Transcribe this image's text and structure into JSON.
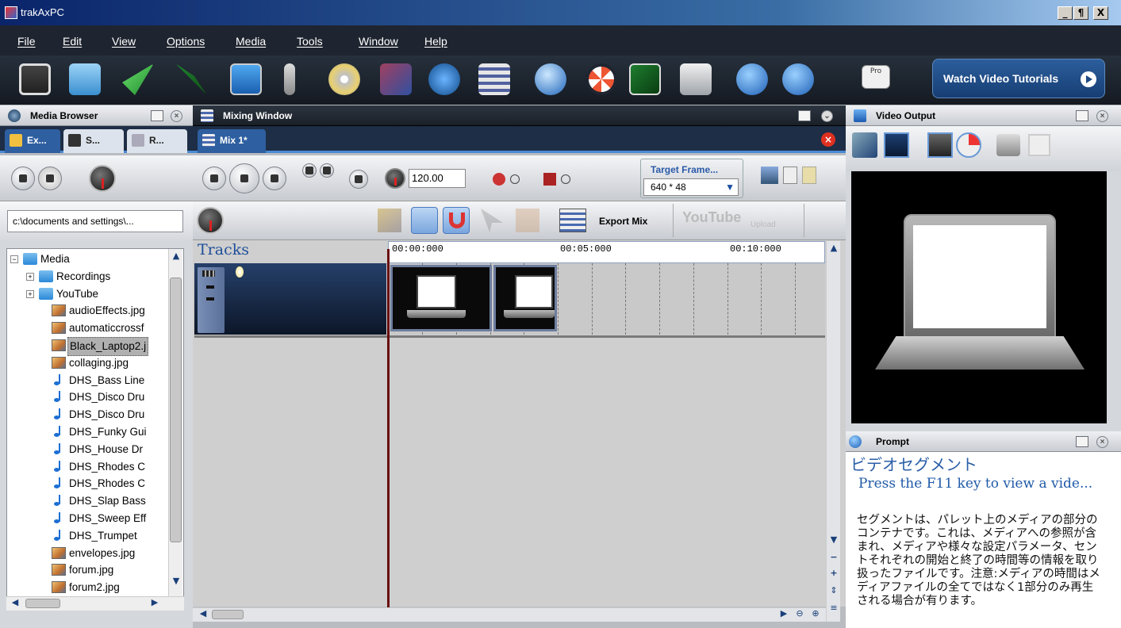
{
  "window": {
    "title": "trakAxPC",
    "controls": [
      "_",
      "¶",
      "X"
    ]
  },
  "menu": [
    "File",
    "Edit",
    "View",
    "Options",
    "Media",
    "Tools",
    "Window",
    "Help"
  ],
  "toolbar": {
    "icons": [
      "save-icon",
      "open-icon",
      "import-icon",
      "export-icon",
      "monitor-icon",
      "microphone-icon",
      "cd-burn-icon",
      "effects-icon",
      "globe-radar-icon",
      "list-icon",
      "world-icon",
      "lifebuoy-icon",
      "video-board-icon",
      "download-icon",
      "help-bubble-icon",
      "info-icon"
    ],
    "pro_badge": "Pro",
    "watch_label": "Watch Video Tutorials"
  },
  "media_browser": {
    "title": "Media Browser",
    "tabs": [
      "Ex...",
      "S...",
      "R..."
    ],
    "path": "c:\\documents and settings\\...",
    "tree": [
      {
        "label": "Media",
        "type": "root-folder"
      },
      {
        "label": "Recordings",
        "type": "folder"
      },
      {
        "label": "YouTube",
        "type": "folder"
      },
      {
        "label": "audioEffects.jpg",
        "type": "image"
      },
      {
        "label": "automaticcrossf",
        "type": "image"
      },
      {
        "label": "Black_Laptop2.j",
        "type": "image",
        "selected": true
      },
      {
        "label": "collaging.jpg",
        "type": "image"
      },
      {
        "label": "DHS_Bass Line",
        "type": "audio"
      },
      {
        "label": "DHS_Disco Dru",
        "type": "audio"
      },
      {
        "label": "DHS_Disco Dru",
        "type": "audio"
      },
      {
        "label": "DHS_Funky Gui",
        "type": "audio"
      },
      {
        "label": "DHS_House Dr",
        "type": "audio"
      },
      {
        "label": "DHS_Rhodes C",
        "type": "audio"
      },
      {
        "label": "DHS_Rhodes C",
        "type": "audio"
      },
      {
        "label": "DHS_Slap Bass",
        "type": "audio"
      },
      {
        "label": "DHS_Sweep Eff",
        "type": "audio"
      },
      {
        "label": "DHS_Trumpet",
        "type": "audio"
      },
      {
        "label": "envelopes.jpg",
        "type": "image"
      },
      {
        "label": "forum.jpg",
        "type": "image"
      },
      {
        "label": "forum2.jpg",
        "type": "image"
      }
    ]
  },
  "mixing": {
    "title": "Mixing Window",
    "tab": "Mix 1*",
    "tempo": "120.00",
    "target_frame_label": "Target Frame...",
    "target_frame_value": "640 * 48",
    "export_label": "Export Mix",
    "youtube_label": "YouTube",
    "upload_label": "Upload",
    "tracks_label": "Tracks",
    "ruler": [
      "00:00:000",
      "00:05:000",
      "00:10:000"
    ]
  },
  "video_output": {
    "title": "Video Output"
  },
  "prompt": {
    "title": "Prompt",
    "heading_jp": "ビデオセグメント",
    "heading_en": "Press the F11 key to view a vide...",
    "body": "セグメントは、パレット上のメディアの部分のコンテナです。これは、メディアへの参照が含まれ、メディアや様々な設定パラメータ、セントそれぞれの開始と終了の時間等の情報を取り扱ったファイルです。注意:メディアの時間はメディアファイルの全てではなく1部分のみ再生される場合が有ります。"
  },
  "colors": {
    "accent": "#2e5fa0",
    "toolbar_bg": "#1f2530",
    "track_bg": "#26406a"
  }
}
